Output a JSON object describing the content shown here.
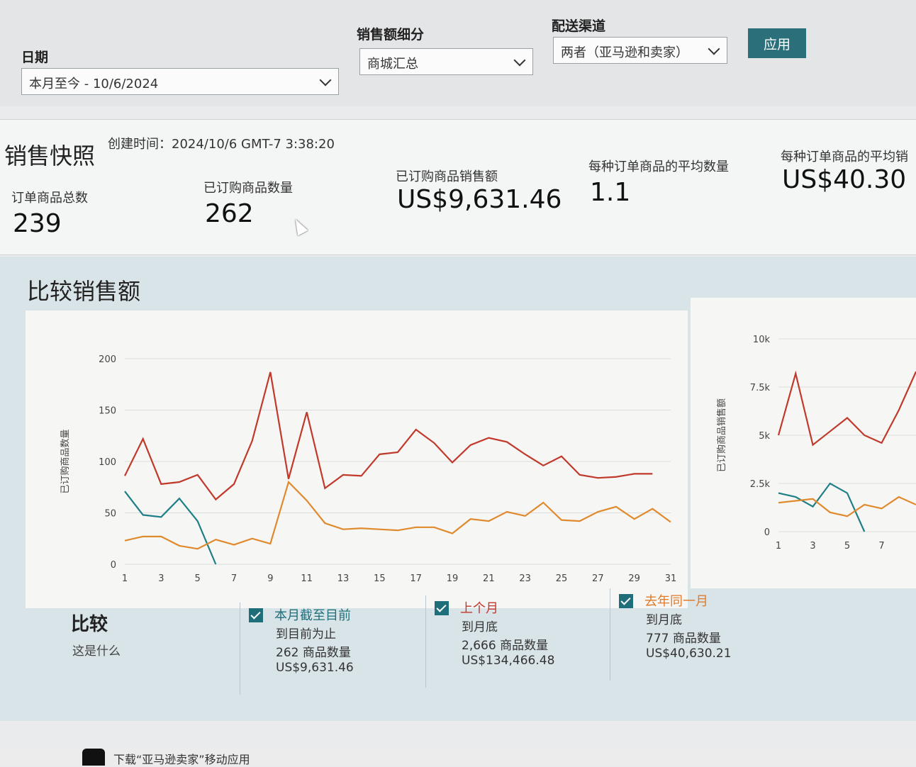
{
  "filters": {
    "date": {
      "label": "日期",
      "value": "本月至今 - 10/6/2024"
    },
    "breakdown": {
      "label": "销售额细分",
      "value": "商城汇总"
    },
    "channel": {
      "label": "配送渠道",
      "value": "两者（亚马逊和卖家）"
    },
    "apply_label": "应用"
  },
  "snapshot": {
    "title": "销售快照",
    "created": "创建时间：2024/10/6 GMT-7 3:38:20",
    "metrics": [
      {
        "label": "订单商品总数",
        "value": "239"
      },
      {
        "label": "已订购商品数量",
        "value": "262"
      },
      {
        "label": "已订购商品销售额",
        "value": "US$9,631.46"
      },
      {
        "label": "每种订单商品的平均数量",
        "value": "1.1"
      },
      {
        "label": "每种订单商品的平均销",
        "value": "US$40.30"
      }
    ]
  },
  "compare": {
    "title": "比较销售额",
    "legend_title": "比较",
    "legend_sub": "这是什么",
    "items": [
      {
        "name": "本月截至目前",
        "color": "#1f6f7a",
        "line1": "到目前为止",
        "line2": "262 商品数量",
        "line3": "US$9,631.46"
      },
      {
        "name": "上个月",
        "color": "#c0392b",
        "line1": "到月底",
        "line2": "2,666 商品数量",
        "line3": "US$134,466.48"
      },
      {
        "name": "去年同一月",
        "color": "#e07b2a",
        "line1": "到月底",
        "line2": "777 商品数量",
        "line3": "US$40,630.21"
      }
    ]
  },
  "chart_data": [
    {
      "type": "line",
      "ylabel": "已订购商品数量",
      "ylim": [
        0,
        200
      ],
      "yticks": [
        "0",
        "50",
        "100",
        "150",
        "200"
      ],
      "xticks": [
        "1",
        "3",
        "5",
        "7",
        "9",
        "11",
        "13",
        "15",
        "17",
        "19",
        "21",
        "23",
        "25",
        "27",
        "29",
        "31"
      ],
      "series": [
        {
          "name": "本月截至目前",
          "color": "#1f7f86",
          "x": [
            1,
            2,
            3,
            4,
            5,
            6
          ],
          "values": [
            71,
            48,
            46,
            64,
            42,
            0
          ]
        },
        {
          "name": "上个月",
          "color": "#c0392b",
          "x": [
            1,
            2,
            3,
            4,
            5,
            6,
            7,
            8,
            9,
            10,
            11,
            12,
            13,
            14,
            15,
            16,
            17,
            18,
            19,
            20,
            21,
            22,
            23,
            24,
            25,
            26,
            27,
            28,
            29,
            30
          ],
          "values": [
            86,
            122,
            78,
            80,
            87,
            63,
            78,
            120,
            187,
            83,
            148,
            74,
            87,
            86,
            107,
            109,
            131,
            118,
            99,
            116,
            123,
            119,
            107,
            96,
            105,
            87,
            84,
            85,
            88,
            88
          ]
        },
        {
          "name": "去年同一月",
          "color": "#e08a2e",
          "x": [
            1,
            2,
            3,
            4,
            5,
            6,
            7,
            8,
            9,
            10,
            11,
            12,
            13,
            14,
            15,
            16,
            17,
            18,
            19,
            20,
            21,
            22,
            23,
            24,
            25,
            26,
            27,
            28,
            29,
            30,
            31
          ],
          "values": [
            23,
            27,
            27,
            18,
            15,
            24,
            19,
            25,
            20,
            80,
            62,
            40,
            34,
            35,
            34,
            33,
            36,
            36,
            30,
            44,
            42,
            51,
            47,
            60,
            43,
            42,
            51,
            56,
            44,
            54,
            41
          ]
        }
      ]
    },
    {
      "type": "line",
      "ylabel": "已订购商品销售额",
      "ylim": [
        0,
        10000
      ],
      "yticks": [
        "0",
        "2.5k",
        "5k",
        "7.5k",
        "10k"
      ],
      "xticks": [
        "1",
        "3",
        "5",
        "7"
      ],
      "series": [
        {
          "name": "本月截至目前",
          "color": "#1f7f86",
          "x": [
            1,
            2,
            3,
            4,
            5,
            6
          ],
          "values": [
            2000,
            1800,
            1300,
            2500,
            2000,
            0
          ]
        },
        {
          "name": "上个月",
          "color": "#c0392b",
          "x": [
            1,
            2,
            3,
            4,
            5,
            6,
            7,
            8,
            9
          ],
          "values": [
            5000,
            8200,
            4500,
            5200,
            5900,
            5000,
            4600,
            6300,
            8300
          ]
        },
        {
          "name": "去年同一月",
          "color": "#e08a2e",
          "x": [
            1,
            2,
            3,
            4,
            5,
            6,
            7,
            8,
            9
          ],
          "values": [
            1500,
            1600,
            1700,
            1000,
            800,
            1400,
            1200,
            1800,
            1400
          ]
        }
      ]
    }
  ],
  "footer": {
    "text": "下载“亚马逊卖家”移动应用"
  }
}
